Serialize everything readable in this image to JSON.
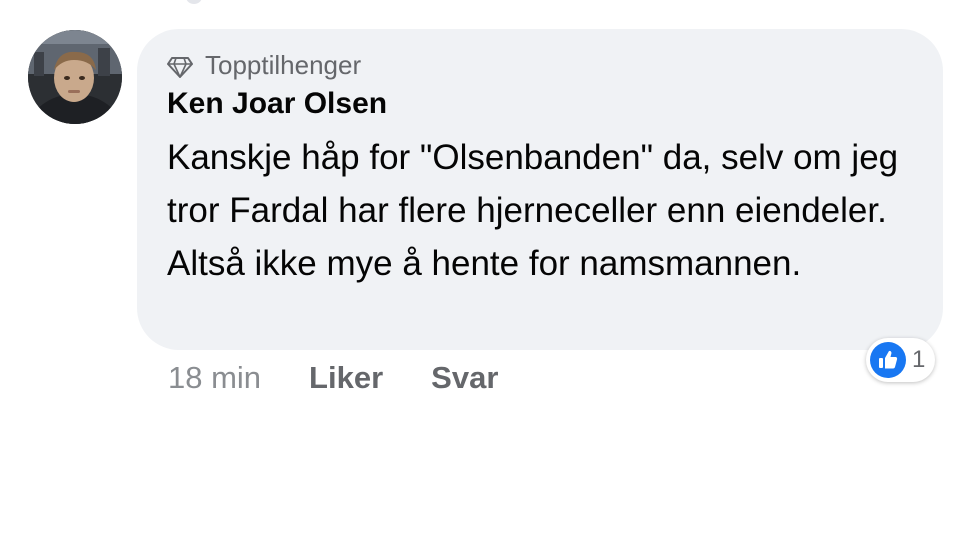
{
  "comment": {
    "badge_label": "Topptilhenger",
    "author": "Ken Joar Olsen",
    "text": "Kanskje håp for \"Olsenbanden\" da, selv om jeg tror Fardal har flere hjerneceller enn eiendeler. Altså ikke mye å hente for namsmannen.",
    "timestamp": "18 min",
    "like_label": "Liker",
    "reply_label": "Svar",
    "reaction_count": "1",
    "reaction_type": "like"
  },
  "icons": {
    "badge": "diamond-icon",
    "reaction": "thumbs-up-icon"
  },
  "colors": {
    "bubble_bg": "#f0f2f5",
    "text": "#050505",
    "secondary_text": "#65676b",
    "like_blue": "#1877f2"
  }
}
